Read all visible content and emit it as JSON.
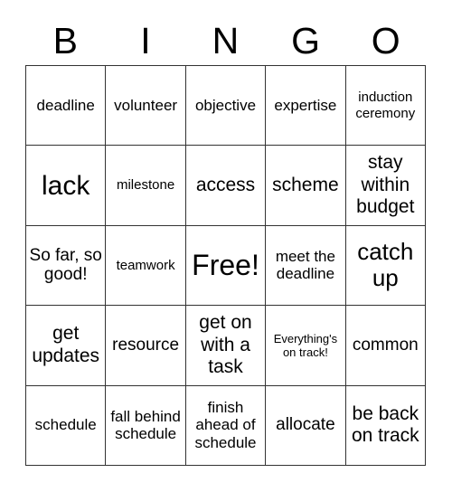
{
  "card": {
    "header_letters": [
      "B",
      "I",
      "N",
      "G",
      "O"
    ],
    "border_color": "#333333",
    "background_color": "#ffffff",
    "text_color": "#000000",
    "rows": [
      [
        {
          "text": "deadline",
          "size": "md"
        },
        {
          "text": "volunteer",
          "size": "md"
        },
        {
          "text": "objective",
          "size": "md"
        },
        {
          "text": "expertise",
          "size": "md"
        },
        {
          "text": "induction ceremony",
          "size": "sm"
        }
      ],
      [
        {
          "text": "lack",
          "size": "3xl"
        },
        {
          "text": "milestone",
          "size": "sm"
        },
        {
          "text": "access",
          "size": "xl"
        },
        {
          "text": "scheme",
          "size": "xl"
        },
        {
          "text": "stay within budget",
          "size": "xl"
        }
      ],
      [
        {
          "text": "So far, so good!",
          "size": "lg"
        },
        {
          "text": "teamwork",
          "size": "sm"
        },
        {
          "text": "Free!",
          "size": "free"
        },
        {
          "text": "meet the deadline",
          "size": "md"
        },
        {
          "text": "catch up",
          "size": "2xl"
        }
      ],
      [
        {
          "text": "get updates",
          "size": "xl"
        },
        {
          "text": "resource",
          "size": "lg"
        },
        {
          "text": "get on with a task",
          "size": "xl"
        },
        {
          "text": "Everything's on track!",
          "size": "xs"
        },
        {
          "text": "common",
          "size": "lg"
        }
      ],
      [
        {
          "text": "schedule",
          "size": "md"
        },
        {
          "text": "fall behind schedule",
          "size": "md"
        },
        {
          "text": "finish ahead of schedule",
          "size": "md"
        },
        {
          "text": "allocate",
          "size": "lg"
        },
        {
          "text": "be back on track",
          "size": "xl"
        }
      ]
    ]
  }
}
